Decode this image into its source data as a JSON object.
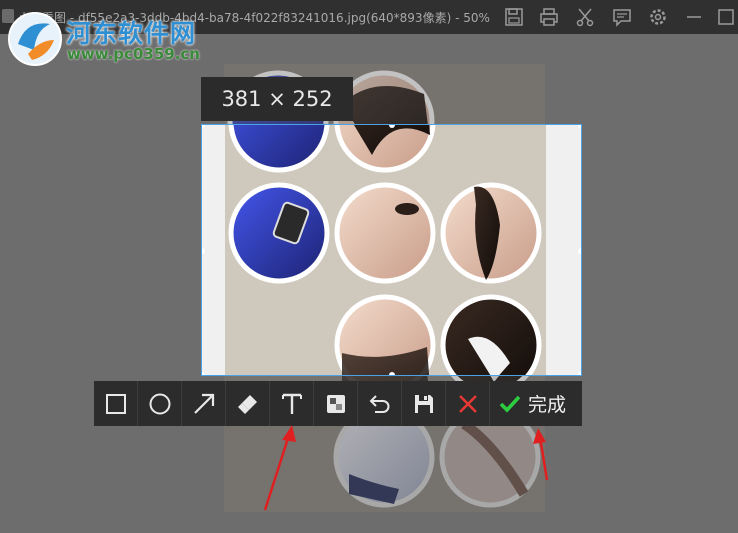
{
  "window": {
    "title": "小视看图 - df55e2a3-3ddb-4bd4-ba78-4f022f83241016.jpg(640*893像素) - 50%",
    "toolbar_icons": [
      "save-icon",
      "print-icon",
      "scissors-icon",
      "comment-icon",
      "settings-icon",
      "minimize-icon",
      "maximize-icon"
    ]
  },
  "watermark": {
    "site_name": "河东软件网",
    "url": "www.pc0359.cn"
  },
  "selection": {
    "size_label": "381 × 252"
  },
  "editor_toolbar": {
    "tools": [
      "rectangle-icon",
      "ellipse-icon",
      "arrow-icon",
      "brush-icon",
      "text-icon",
      "mosaic-icon",
      "undo-icon",
      "save-icon",
      "cancel-icon"
    ],
    "done_label": "完成",
    "accent_color": "#2ecc40",
    "cancel_color": "#e53935"
  },
  "annotations": {
    "arrow_color": "#e02020"
  }
}
